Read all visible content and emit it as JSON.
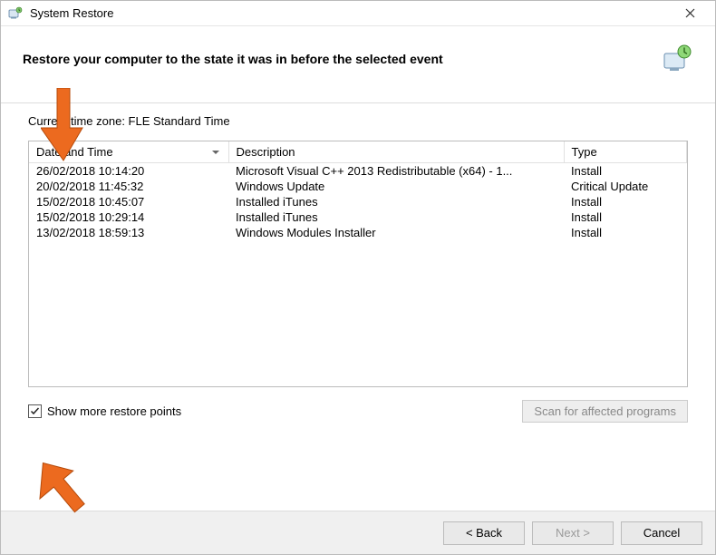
{
  "titlebar": {
    "title": "System Restore"
  },
  "header": {
    "text": "Restore your computer to the state it was in before the selected event"
  },
  "timezone_label": "Current time zone: FLE Standard Time",
  "columns": {
    "date": "Date and Time",
    "desc": "Description",
    "type": "Type"
  },
  "rows": [
    {
      "date": "26/02/2018 10:14:20",
      "desc": "Microsoft Visual C++ 2013 Redistributable (x64) - 1...",
      "type": "Install"
    },
    {
      "date": "20/02/2018 11:45:32",
      "desc": "Windows Update",
      "type": "Critical Update"
    },
    {
      "date": "15/02/2018 10:45:07",
      "desc": "Installed iTunes",
      "type": "Install"
    },
    {
      "date": "15/02/2018 10:29:14",
      "desc": "Installed iTunes",
      "type": "Install"
    },
    {
      "date": "13/02/2018 18:59:13",
      "desc": "Windows Modules Installer",
      "type": "Install"
    }
  ],
  "checkbox": {
    "label": "Show more restore points",
    "checked": true
  },
  "scan_button": "Scan for affected programs",
  "footer": {
    "back": "< Back",
    "next": "Next >",
    "cancel": "Cancel"
  }
}
